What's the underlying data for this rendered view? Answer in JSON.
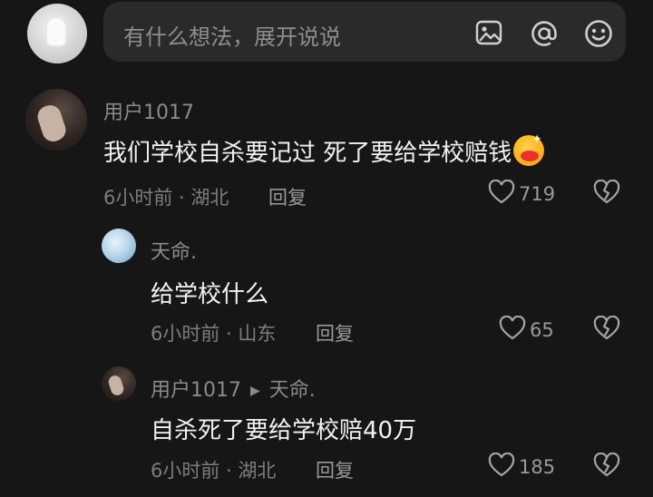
{
  "composer": {
    "placeholder": "有什么想法，展开说说",
    "icons": [
      "image-icon",
      "at-mention-icon",
      "emoji-icon"
    ]
  },
  "comments": [
    {
      "username": "用户1017",
      "text": "我们学校自杀要记过 死了要给学校赔钱",
      "time_location": "6小时前 · 湖北",
      "reply_label": "回复",
      "likes": "719",
      "replies": [
        {
          "username": "天命.",
          "text": "给学校什么",
          "time_location": "6小时前 · 山东",
          "reply_label": "回复",
          "likes": "65"
        },
        {
          "username": "用户1017",
          "reply_to": "天命.",
          "text": "自杀死了要给学校赔40万",
          "time_location": "6小时前 · 湖北",
          "reply_label": "回复",
          "likes": "185"
        }
      ]
    }
  ],
  "colors": {
    "background": "#161616",
    "input_bar": "#2a2a2a",
    "text_primary": "#f2f2f2",
    "text_secondary": "#7d7d7d"
  }
}
